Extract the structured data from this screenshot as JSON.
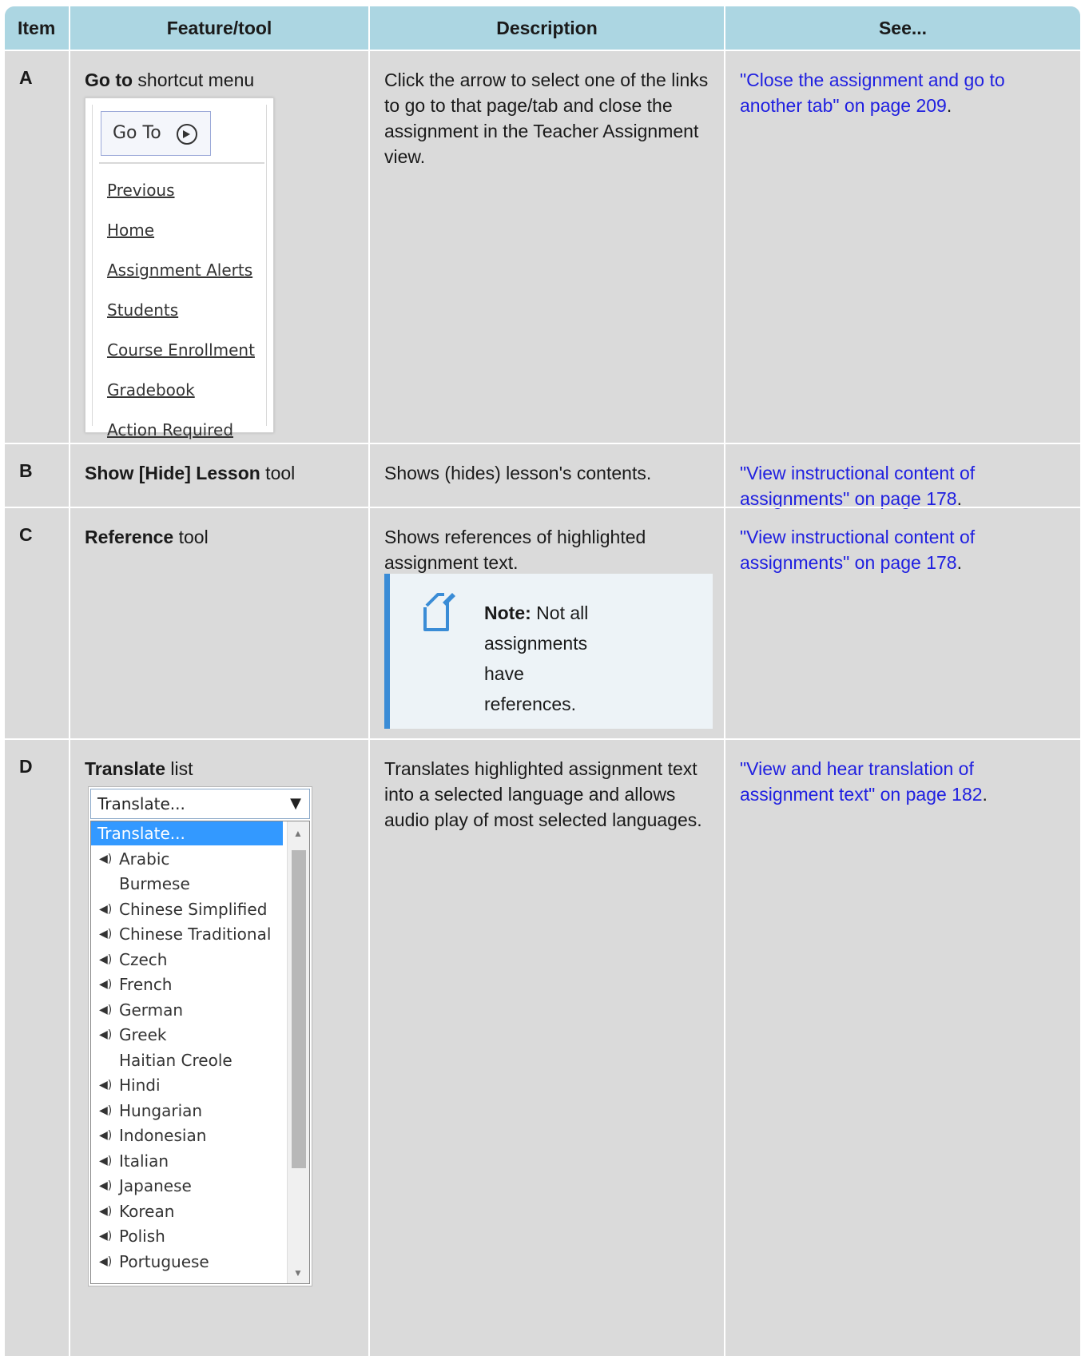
{
  "headers": {
    "item": "Item",
    "feature": "Feature/tool",
    "description": "Description",
    "see": "See..."
  },
  "rows": [
    {
      "item": "A",
      "feature_bold": "Go to",
      "feature_rest": " shortcut menu",
      "description": "Click the arrow to select one of the links to go to that page/tab and close the assignment in the Teacher Assignment view.",
      "see_link": "\"Close the assignment and go to another tab\" on page 209",
      "see_suffix": "."
    },
    {
      "item": "B",
      "feature_bold": "Show [Hide] Lesson",
      "feature_rest": " tool",
      "description": "Shows (hides) lesson's contents.",
      "see_link": "\"View instructional content of assignments\" on page 178",
      "see_suffix": "."
    },
    {
      "item": "C",
      "feature_bold": "Reference",
      "feature_rest": " tool",
      "description": "Shows references of highlighted assignment text.",
      "see_link": "\"View instructional content of assignments\" on page 178",
      "see_suffix": "."
    },
    {
      "item": "D",
      "feature_bold": "Translate",
      "feature_rest": " list",
      "description": "Translates highlighted assignment text into a selected language and allows audio play of most selected languages.",
      "see_link": "\"View and hear translation of assignment text\" on page 182",
      "see_suffix": "."
    }
  ],
  "goto_menu": {
    "button_label": "Go To",
    "icon": "arrow-circle-right-icon",
    "links": [
      "Previous",
      "Home",
      "Assignment Alerts",
      "Students",
      "Course Enrollment",
      "Gradebook",
      "Action Required"
    ]
  },
  "note": {
    "label": "Note:",
    "text": " Not all assignments have references.",
    "icon": "note-pencil-icon",
    "accent": "#3a8cd6"
  },
  "translate": {
    "selected": "Translate...",
    "options": [
      {
        "label": "Translate...",
        "audio": false,
        "selected": true
      },
      {
        "label": "Arabic",
        "audio": true
      },
      {
        "label": "Burmese",
        "audio": false
      },
      {
        "label": "Chinese Simplified",
        "audio": true
      },
      {
        "label": "Chinese Traditional",
        "audio": true
      },
      {
        "label": "Czech",
        "audio": true
      },
      {
        "label": "French",
        "audio": true
      },
      {
        "label": "German",
        "audio": true
      },
      {
        "label": "Greek",
        "audio": true
      },
      {
        "label": "Haitian Creole",
        "audio": false
      },
      {
        "label": "Hindi",
        "audio": true
      },
      {
        "label": "Hungarian",
        "audio": true
      },
      {
        "label": "Indonesian",
        "audio": true
      },
      {
        "label": "Italian",
        "audio": true
      },
      {
        "label": "Japanese",
        "audio": true
      },
      {
        "label": "Korean",
        "audio": true
      },
      {
        "label": "Polish",
        "audio": true
      },
      {
        "label": "Portuguese",
        "audio": true
      }
    ]
  },
  "colors": {
    "header_bg": "#acd6e2",
    "row_bg": "#dadada",
    "link": "#1f1fe0"
  }
}
